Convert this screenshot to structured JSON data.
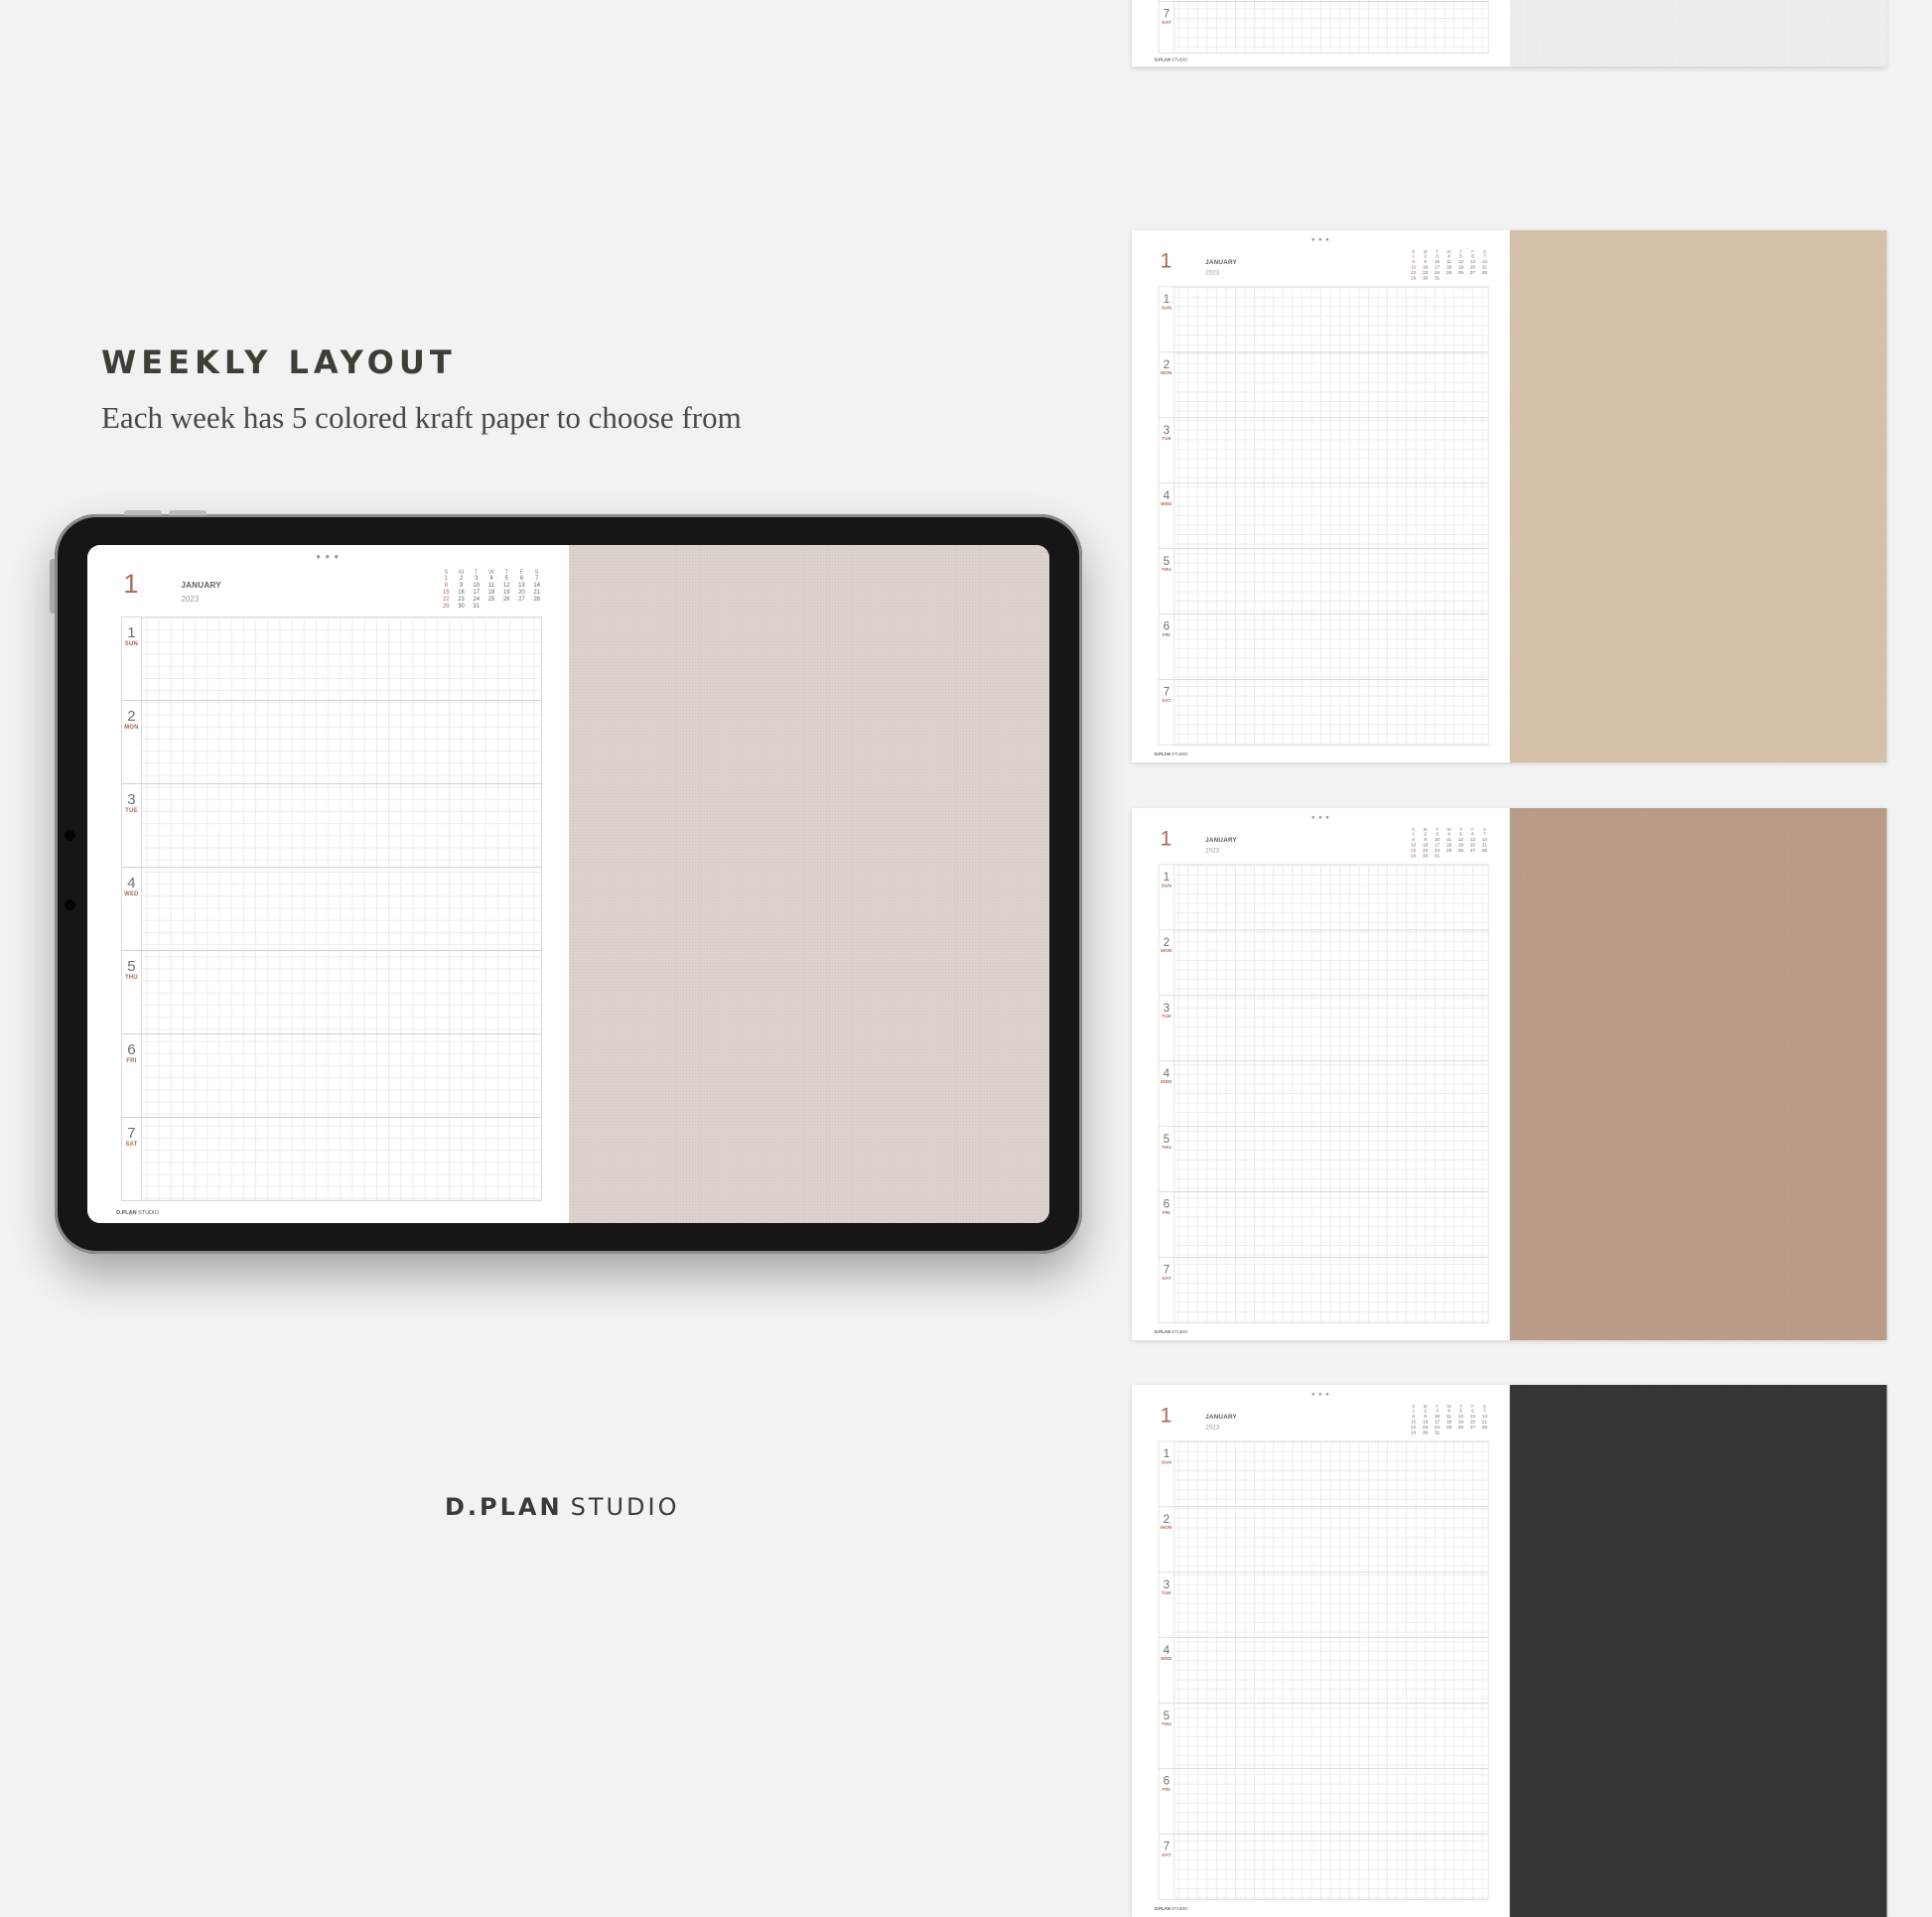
{
  "heading": "WEEKLY LAYOUT",
  "subheading": "Each week has 5 colored kraft paper to choose from",
  "brand": {
    "bold": "D.PLAN",
    "light": "STUDIO"
  },
  "planner": {
    "week_number": "1",
    "month": "JANUARY",
    "year": "2023",
    "mini_calendar": {
      "headers": [
        "S",
        "M",
        "T",
        "W",
        "T",
        "F",
        "S"
      ],
      "days": [
        "1",
        "2",
        "3",
        "4",
        "5",
        "6",
        "7",
        "8",
        "9",
        "10",
        "11",
        "12",
        "13",
        "14",
        "15",
        "16",
        "17",
        "18",
        "19",
        "20",
        "21",
        "22",
        "23",
        "24",
        "25",
        "26",
        "27",
        "28",
        "29",
        "30",
        "31"
      ]
    },
    "days": [
      {
        "num": "1",
        "name": "SUN"
      },
      {
        "num": "2",
        "name": "MON"
      },
      {
        "num": "3",
        "name": "TUE"
      },
      {
        "num": "4",
        "name": "WED"
      },
      {
        "num": "5",
        "name": "THU"
      },
      {
        "num": "6",
        "name": "FRI"
      },
      {
        "num": "7",
        "name": "SAT"
      }
    ],
    "footer": {
      "bold": "D.PLAN",
      "light": "STUDIO"
    }
  },
  "paper_colors": {
    "tablet": "#ddd3cd",
    "thumb1": "#f0efee",
    "thumb2": "#d7c3ab",
    "thumb3": "#bb9e89",
    "thumb4": "#373634"
  },
  "tablet": {
    "bezel_color": "#161616",
    "frame_color": "#8b8b8b",
    "camera_color": "#050505"
  }
}
